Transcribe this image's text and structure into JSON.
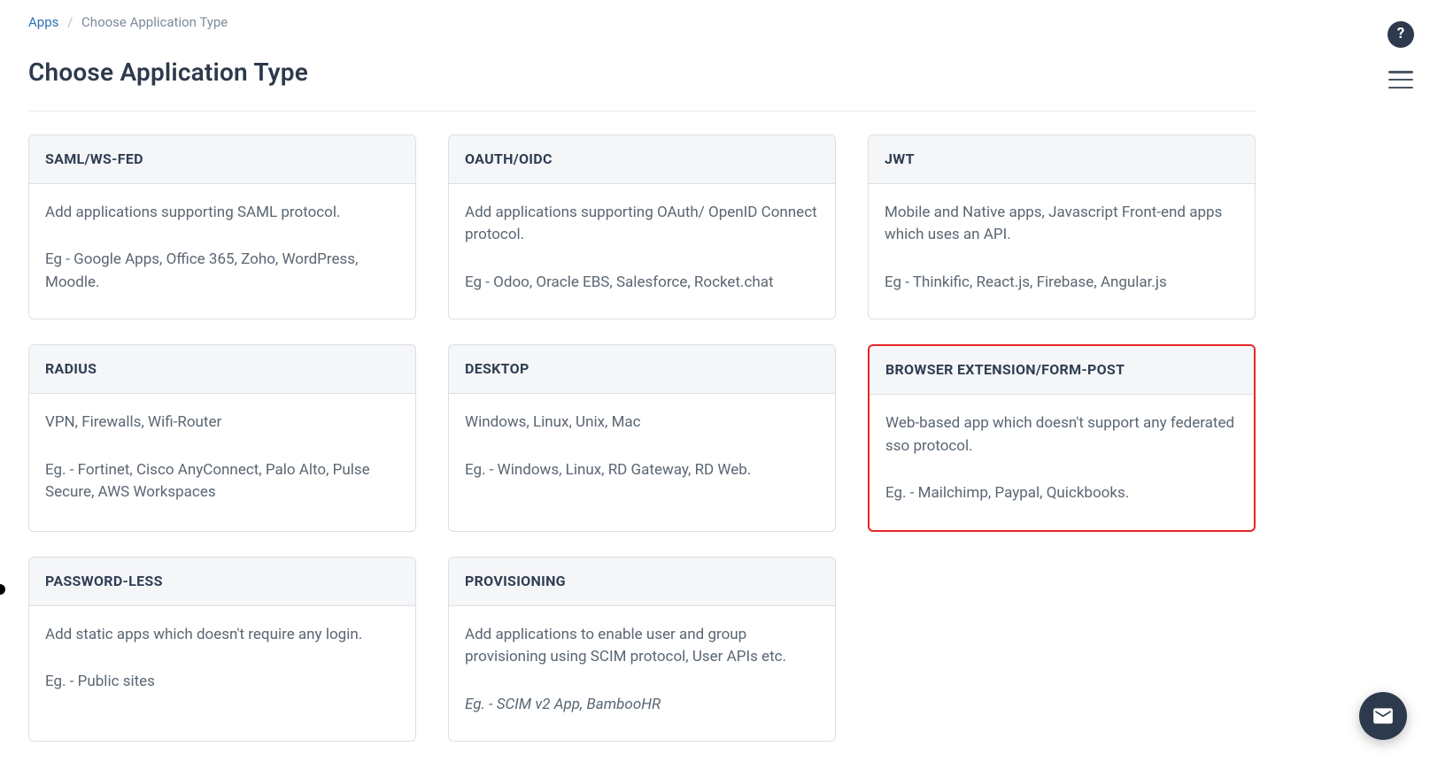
{
  "breadcrumb": {
    "root": "Apps",
    "current": "Choose Application Type"
  },
  "page": {
    "title": "Choose Application Type"
  },
  "cards": [
    {
      "id": "saml",
      "title": "SAML/WS-FED",
      "desc": "Add applications supporting SAML protocol.",
      "examples": "Eg - Google Apps, Office 365, Zoho, WordPress, Moodle.",
      "highlight": false
    },
    {
      "id": "oauth",
      "title": "OAUTH/OIDC",
      "desc": "Add applications supporting OAuth/ OpenID Connect protocol.",
      "examples": "Eg - Odoo, Oracle EBS, Salesforce, Rocket.chat",
      "highlight": false
    },
    {
      "id": "jwt",
      "title": "JWT",
      "desc": "Mobile and Native apps, Javascript Front-end apps which uses an API.",
      "examples": "Eg - Thinkific, React.js, Firebase, Angular.js",
      "highlight": false
    },
    {
      "id": "radius",
      "title": "RADIUS",
      "desc": "VPN, Firewalls, Wifi-Router",
      "examples": "Eg. - Fortinet, Cisco AnyConnect, Palo Alto, Pulse Secure, AWS Workspaces",
      "highlight": false
    },
    {
      "id": "desktop",
      "title": "DESKTOP",
      "desc": "Windows, Linux, Unix, Mac",
      "examples": "Eg. - Windows, Linux, RD Gateway, RD Web.",
      "highlight": false
    },
    {
      "id": "browser-ext",
      "title": "BROWSER EXTENSION/FORM-POST",
      "desc": "Web-based app which doesn't support any federated sso protocol.",
      "examples": "Eg. - Mailchimp, Paypal, Quickbooks.",
      "highlight": true
    },
    {
      "id": "passwordless",
      "title": "PASSWORD-LESS",
      "desc": "Add static apps which doesn't require any login.",
      "examples": "Eg. - Public sites",
      "highlight": false
    },
    {
      "id": "provisioning",
      "title": "PROVISIONING",
      "desc": "Add applications to enable user and group provisioning using SCIM protocol, User APIs etc.",
      "examples": "Eg. - SCIM v2 App, BambooHR",
      "examples_italic": true,
      "highlight": false
    }
  ],
  "icons": {
    "help": "?",
    "menu": "menu-icon",
    "chat": "mail-icon"
  }
}
